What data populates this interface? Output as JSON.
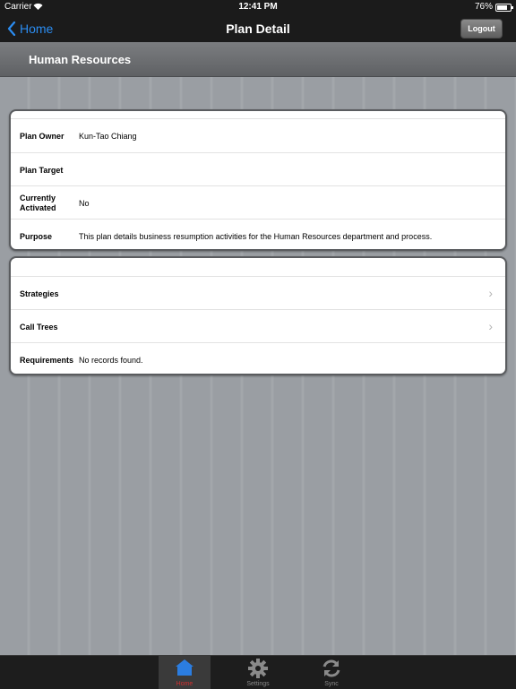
{
  "status_bar": {
    "carrier": "Carrier",
    "time": "12:41 PM",
    "battery": "76%",
    "battery_level": 0.76
  },
  "nav_bar": {
    "back_label": "Home",
    "title": "Plan Detail",
    "logout_label": "Logout"
  },
  "section": {
    "title": "Human Resources"
  },
  "details": {
    "rows": [
      {
        "label": "Plan Owner",
        "value": "Kun-Tao Chiang"
      },
      {
        "label": "Plan Target",
        "value": ""
      },
      {
        "label": "Currently Activated",
        "value": "No"
      },
      {
        "label": "Purpose",
        "value": "This plan details business resumption activities for the Human Resources department and process."
      }
    ]
  },
  "links": {
    "rows": [
      {
        "label": "Strategies",
        "value": ""
      },
      {
        "label": "Call Trees",
        "value": ""
      },
      {
        "label": "Requirements",
        "value": "No records found."
      }
    ]
  },
  "tab_bar": {
    "tabs": [
      {
        "label": "Home",
        "icon": "home-icon",
        "selected": true
      },
      {
        "label": "Settings",
        "icon": "gear-icon",
        "selected": false
      },
      {
        "label": "Sync",
        "icon": "sync-icon",
        "selected": false
      }
    ]
  },
  "colors": {
    "accent": "#2b8cf0",
    "selected_tab": "#d23030",
    "background": "#9a9ea3"
  }
}
